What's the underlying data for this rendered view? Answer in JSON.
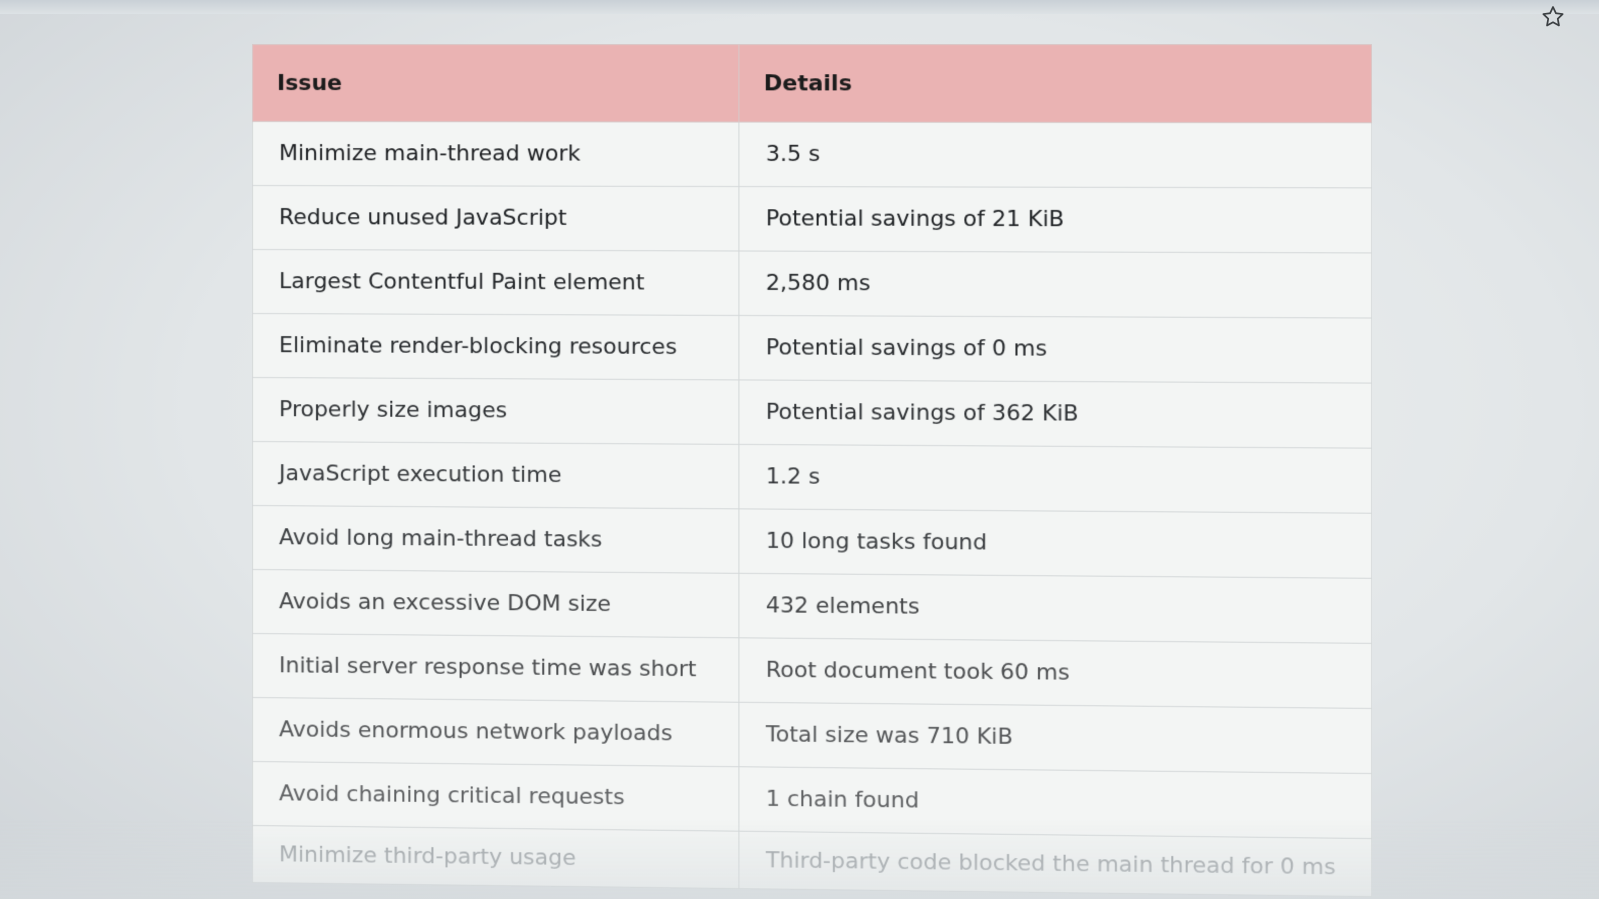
{
  "toolbar": {
    "bookmark_icon": "star-outline-icon"
  },
  "table": {
    "headers": {
      "issue": "Issue",
      "details": "Details"
    },
    "rows": [
      {
        "issue": "Minimize main-thread work",
        "details": "3.5 s"
      },
      {
        "issue": "Reduce unused JavaScript",
        "details": "Potential savings of 21 KiB"
      },
      {
        "issue": "Largest Contentful Paint element",
        "details": "2,580 ms"
      },
      {
        "issue": "Eliminate render-blocking resources",
        "details": "Potential savings of 0 ms"
      },
      {
        "issue": "Properly size images",
        "details": "Potential savings of 362 KiB"
      },
      {
        "issue": "JavaScript execution time",
        "details": "1.2 s"
      },
      {
        "issue": "Avoid long main-thread tasks",
        "details": "10 long tasks found"
      },
      {
        "issue": "Avoids an excessive DOM size",
        "details": "432 elements"
      },
      {
        "issue": "Initial server response time was short",
        "details": "Root document took 60 ms"
      },
      {
        "issue": "Avoids enormous network payloads",
        "details": "Total size was 710 KiB"
      },
      {
        "issue": "Avoid chaining critical requests",
        "details": "1 chain found"
      },
      {
        "issue": "Minimize third-party usage",
        "details": "Third-party code blocked the main thread for 0 ms"
      }
    ]
  },
  "colors": {
    "header_bg": "#eab3b3",
    "table_bg": "#f3f5f4",
    "border": "#d4d8d9"
  }
}
